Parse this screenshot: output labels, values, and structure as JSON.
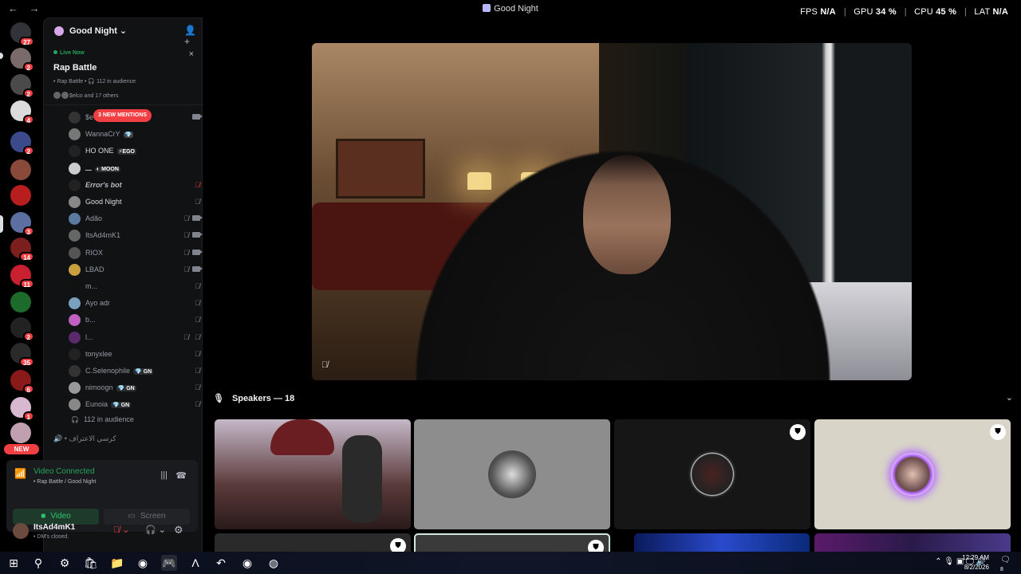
{
  "titlebar": {
    "title": "Good Night",
    "back": "←",
    "forward": "→"
  },
  "overlay": {
    "fps_label": "FPS",
    "fps": "N/A",
    "gpu_label": "GPU",
    "gpu": "34 %",
    "cpu_label": "CPU",
    "cpu": "45 %",
    "lat_label": "LAT",
    "lat": "N/A"
  },
  "rail": {
    "servers": [
      {
        "badge": "27"
      },
      {
        "badge": "2"
      },
      {
        "badge": "2"
      },
      {
        "badge": "4"
      },
      {
        "badge": "2"
      },
      {
        "badge": ""
      },
      {
        "badge": ""
      },
      {
        "badge": "3"
      },
      {
        "badge": "14"
      },
      {
        "badge": "11"
      },
      {
        "badge": ""
      },
      {
        "badge": "2"
      },
      {
        "badge": "35"
      },
      {
        "badge": "6"
      },
      {
        "badge": "1"
      },
      {
        "badge": "9"
      }
    ],
    "new_label": "NEW"
  },
  "server": {
    "name": "Good Night"
  },
  "live": {
    "status": "Live Now",
    "title": "Rap Battle",
    "meta": "• Rap Battle • 🎧 112 in audience",
    "others": "$elco and 17 others",
    "close": "×"
  },
  "mentions": "3 NEW MENTIONS",
  "members": [
    {
      "name": "$e",
      "tag": "",
      "tag_color": "",
      "style": "dim"
    },
    {
      "name": "WannaCrY",
      "tag": "💎",
      "tag_color": "#444",
      "style": "dim"
    },
    {
      "name": "ΗΟ ΟΝΕ",
      "tag": "⚡EGO",
      "tag_color": "#2b2d31",
      "style": ""
    },
    {
      "name": "ـــ",
      "tag": "◐ MOON",
      "tag_color": "#2b2d31",
      "style": ""
    },
    {
      "name": "Error's bot",
      "tag": "",
      "tag_color": "",
      "style": "it"
    },
    {
      "name": "Good Night",
      "tag": "",
      "tag_color": "",
      "style": ""
    },
    {
      "name": "Adão",
      "tag": "",
      "tag_color": "",
      "style": "dim"
    },
    {
      "name": "ItsAd4mK1",
      "tag": "",
      "tag_color": "",
      "style": "dim"
    },
    {
      "name": "RIOX",
      "tag": "",
      "tag_color": "",
      "style": "dim"
    },
    {
      "name": "LBAD",
      "tag": "",
      "tag_color": "",
      "style": "dim"
    },
    {
      "name": "m...",
      "tag": "",
      "tag_color": "",
      "style": "dim"
    },
    {
      "name": "Ayo adr",
      "tag": "",
      "tag_color": "",
      "style": "dim"
    },
    {
      "name": "b...",
      "tag": "",
      "tag_color": "",
      "style": "dim"
    },
    {
      "name": "l...",
      "tag": "",
      "tag_color": "",
      "style": "dim"
    },
    {
      "name": "tonyxlee",
      "tag": "",
      "tag_color": "",
      "style": "dim"
    },
    {
      "name": "C.Selenophile",
      "tag": "💎 GN",
      "tag_color": "#2b2d31",
      "style": "dim"
    },
    {
      "name": "nimoogn",
      "tag": "💎 GN",
      "tag_color": "#2b2d31",
      "style": "dim"
    },
    {
      "name": "Eunoia",
      "tag": "💎 GN",
      "tag_color": "#2b2d31",
      "style": "dim"
    }
  ],
  "audience": "112 in audience",
  "next_channel": "• كرسي الاعتراف",
  "connection": {
    "status": "Video Connected",
    "sub": "• Rap Battle / Good Night",
    "video_label": "Video",
    "screen_label": "Screen"
  },
  "user": {
    "name": "ItsAd4mK1",
    "status": "• DM's closed."
  },
  "stage": {
    "speakers_label": "Speakers — 18"
  },
  "taskbar": {
    "time": "12:29 AM",
    "date": "8/2/2026",
    "notif_count": "8"
  },
  "colors": {
    "green": "#23a55a",
    "red": "#f23f43",
    "sidebar": "#111214"
  }
}
